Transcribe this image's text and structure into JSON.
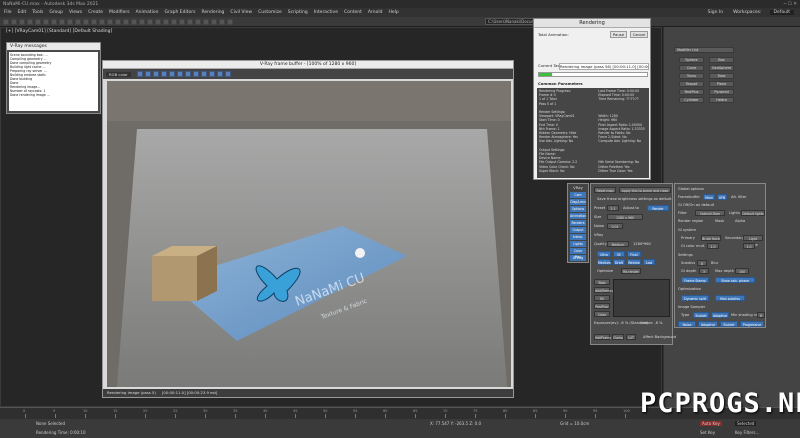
{
  "app": {
    "title": "NaNaMi-CU.max - Autodesk 3ds Max 2021",
    "signin": "Sign In",
    "workspace_label": "Workspaces:",
    "workspace_value": "Default"
  },
  "menu": [
    "File",
    "Edit",
    "Tools",
    "Group",
    "Views",
    "Create",
    "Modifiers",
    "Animation",
    "Graph Editors",
    "Rendering",
    "Civil View",
    "Customize",
    "Scripting",
    "Interactive",
    "Content",
    "Arnold",
    "Help"
  ],
  "toolbar": {
    "path": "C:\\Users\\Nanaki\\Documents\\3ds Max 2021\\"
  },
  "viewport": {
    "label": "[+] [VRayCam01] [Standard] [Default Shading]"
  },
  "vray_messages": {
    "title": "V-Ray messages",
    "lines": [
      "Scene bounding box: ...",
      "Compiling geometry ...",
      "Done compiling geometry",
      "Building light cache ...",
      "Preparing ray server ...",
      "Building embree static",
      "Done building",
      "Done",
      "Rendering image...",
      "Number of raycasts: 1",
      "Done rendering image ..."
    ]
  },
  "vfb": {
    "title": "V-Ray frame buffer - [100% of 1280 x 960]",
    "channel": "RGB color",
    "status": "Rendering image (pass 5)",
    "time": "[00:00:11.0] [00:00:23.9 est]",
    "cloth_line1": "NaNaMi CU",
    "cloth_line2": "Texture & Fabric"
  },
  "render_dialog": {
    "title": "Rendering",
    "total_animation": "Total Animation:",
    "pause": "Pause",
    "cancel": "Cancel",
    "current_task_label": "Current Task:",
    "current_task": "Rendering image (pass 56) [00:00:11.0] [00:00:23.9 est]",
    "progress": 0.12,
    "common_params": "Common Parameters",
    "params_left": [
      "Rendering Progress:",
      "Frame #  0",
      "1 of 1   Total",
      "Pass  0 of 1",
      "",
      "Render Settings:",
      "Viewport: VRayCam01",
      "Start Time: 0",
      "End Time: 0",
      "Nth Frame: 1",
      "Hidden Geometry: Hide",
      "Render Atmosphere: Yes",
      "Use Adv. Lighting: No",
      "",
      "Output Settings:",
      "File Name:",
      "Device Name:",
      "File Output Gamma: 2.2",
      "Video Color Check: No",
      "Super Black: No"
    ],
    "params_right": [
      "Last Frame Time: 0:00:00",
      "Elapsed Time: 0:00:00",
      "Time Remaining: ??:??:??",
      "",
      "",
      "",
      "Width: 1280",
      "Height: 960",
      "Pixel Aspect Ratio: 1.00000",
      "Image Aspect Ratio: 1.33333",
      "Render to Fields: No",
      "Force 2-Sided: No",
      "Compute Adv. Lighting: No",
      "",
      "",
      "",
      "",
      "Nth Serial Numbering: No",
      "Dither Paletted: Yes",
      "Dither True Color: Yes"
    ]
  },
  "command_panel": {
    "dropdown": "Modifier List",
    "buttons": [
      "Sphere",
      "Box",
      "Cone",
      "GeoSphere",
      "Torus",
      "Tube",
      "Teapot",
      "Plane",
      "TextPlus",
      "Pyramid",
      "Cylinder",
      "Hedra"
    ]
  },
  "vray_toolbar": {
    "title": "VRay",
    "items": [
      "Cam",
      "Disp/Lens",
      "Options",
      "Animation",
      "Renders",
      "Output",
      "Interp.",
      "Lights",
      "Color Map",
      "GI Eng",
      "VFB",
      "GBuf",
      "Finalize"
    ]
  },
  "vray_settings": {
    "reset_map": "Reset map",
    "apply_all": "Apply this to scene and close",
    "save_note": "Save these brightness settings as default",
    "preset_label": "Preset",
    "preset_val": "2.1",
    "adjust": "Adjust to",
    "render_btn": "Render",
    "size": "Size",
    "size_val": "1280 x 960",
    "noise": "Noise",
    "noise_val": "0.01",
    "raytrace": "VRay",
    "quality": "Quality",
    "quality_val": "Medium",
    "quality_num": "1280*960",
    "presets_list": [
      "Ultra",
      "IB",
      "Final",
      "Medium",
      "Draft",
      "Review",
      "Low"
    ],
    "optimize": "Optimize",
    "rerender": "Re-render",
    "buttons_col": [
      "Blob",
      "Add/Remove",
      "Fill",
      "PostProc",
      "Clear"
    ],
    "exposure": "Exposure(ev): -6 % (Standard)",
    "linear": "Linear: -6 %",
    "bottom_btns": [
      "HalfFrame",
      "Clamp",
      "LUT"
    ],
    "affect": "Affect Background"
  },
  "vray_settings2": {
    "global": "Global options",
    "framebuffer": "Framebuffer",
    "main": "Main",
    "vfb": "VFB",
    "alt": "Alt. filter",
    "gi_opt": "GI Off/On on default",
    "filter": "Filter",
    "filter_val": "Catmull-Rom",
    "lights": "Lights",
    "lights_val": "Default lights",
    "render_region": "Render region",
    "mask": "Mask",
    "alpha": "Alpha",
    "gi_system": "GI system",
    "primary": "Primary",
    "brute": "Brute force",
    "secondary": "Secondary",
    "lc": "Light cache",
    "gi_color": "GI color mult.",
    "gi_val": "1.0",
    "lc_val": "1.0",
    "settings": "Settings",
    "subdiv": "Subdivs",
    "subdiv_val": "8",
    "blur": "Blur",
    "gi_depth": "GI depth",
    "depth_val": "3",
    "max_depth": "Max depth",
    "max_val": "100",
    "frame_stamp": "Frame Stamp",
    "show_calc": "Show calc. phase",
    "optimization": "Optimization",
    "dyn_split": "Dynamic split",
    "max_subdivs": "Max subdivs",
    "image_sampler": "Image Sampler",
    "type": "Type",
    "type_val": "Bucket",
    "adaptive": "Adaptive",
    "min_shading": "Min shading rate",
    "ms_val": "6",
    "bottom": [
      "Noise",
      "Adaptive",
      "Bucket",
      "Progressive"
    ]
  },
  "timeline": {
    "ticks": [
      "0",
      "5",
      "10",
      "15",
      "20",
      "25",
      "30",
      "35",
      "40",
      "45",
      "50",
      "55",
      "60",
      "65",
      "70",
      "75",
      "80",
      "85",
      "90",
      "95",
      "100"
    ]
  },
  "statusbar": {
    "selection": "None Selected",
    "prompt": "Rendering Time: 0:00:10",
    "coords": "X: 77.547  Y: -263.5  Z: 0.0",
    "grid": "Grid = 10.0cm",
    "autokey": "Auto Key",
    "selected": "Selected",
    "setkey": "Set Key",
    "keyfilters": "Key Filters..."
  },
  "watermark": "PCPROGS.NET"
}
